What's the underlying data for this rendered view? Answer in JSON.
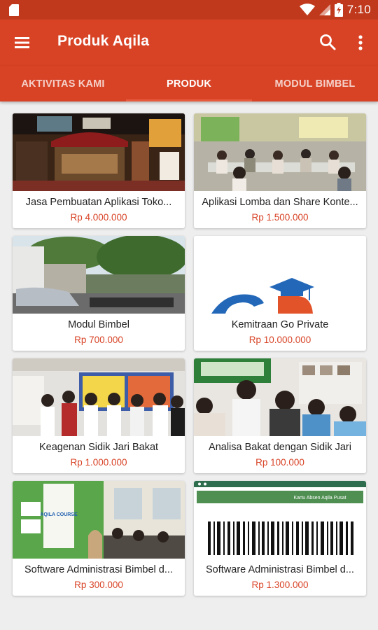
{
  "status_bar": {
    "time": "7:10",
    "icons": [
      "sd-card-icon",
      "wifi-icon",
      "signal-icon",
      "battery-icon"
    ]
  },
  "app_bar": {
    "title": "Produk Aqila",
    "icons": [
      "menu-icon",
      "search-icon",
      "more-vert-icon"
    ]
  },
  "tabs": [
    {
      "label": "AKTIVITAS KAMI",
      "active": false
    },
    {
      "label": "PRODUK",
      "active": true
    },
    {
      "label": "MODUL BIMBEL",
      "active": false
    }
  ],
  "products": [
    {
      "name": "Jasa Pembuatan Aplikasi Toko...",
      "price": "Rp 4.000.000"
    },
    {
      "name": "Aplikasi Lomba dan Share Konte...",
      "price": "Rp 1.500.000"
    },
    {
      "name": "Modul Bimbel",
      "price": "Rp 700.000"
    },
    {
      "name": "Kemitraan Go Private",
      "price": "Rp 10.000.000"
    },
    {
      "name": "Keagenan Sidik Jari Bakat",
      "price": "Rp 1.000.000"
    },
    {
      "name": "Analisa Bakat dengan Sidik Jari",
      "price": "Rp 100.000"
    },
    {
      "name": "Software Administrasi Bimbel d...",
      "price": "Rp 300.000"
    },
    {
      "name": "Software Administrasi Bimbel d...",
      "price": "Rp 1.300.000"
    }
  ],
  "images": {
    "banner_text": "AQILA COURSE",
    "card_title": "Kartu Absen Aqila Pusat"
  },
  "colors": {
    "primary": "#d84326",
    "status_bar": "#c0391c",
    "price": "#d84326",
    "background": "#eeeeee"
  }
}
